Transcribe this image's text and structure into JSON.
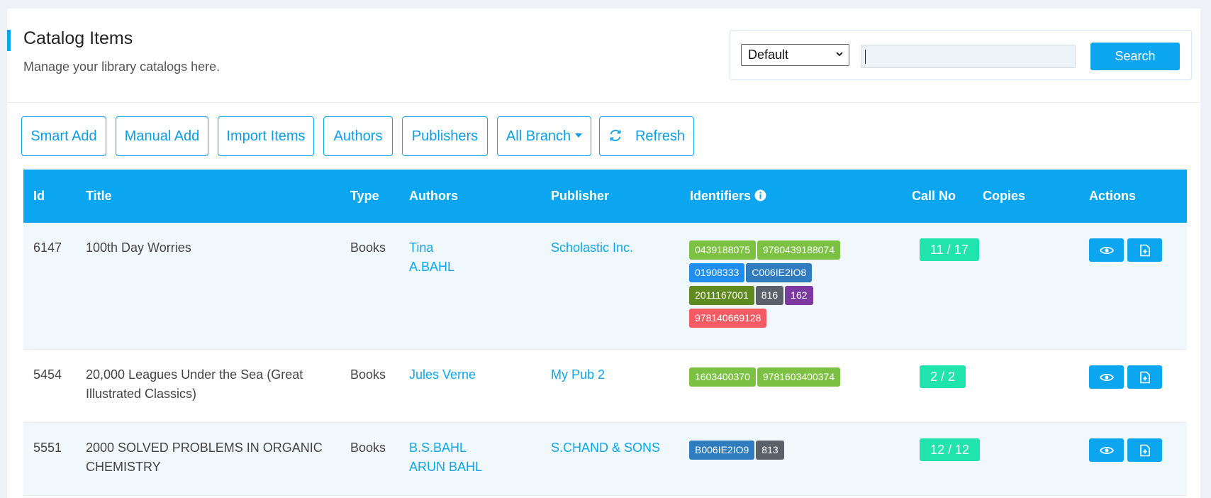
{
  "header": {
    "title": "Catalog Items",
    "subtitle": "Manage your library catalogs here.",
    "search": {
      "select_value": "Default",
      "input_value": "",
      "button_label": "Search"
    }
  },
  "toolbar": {
    "smart_add": "Smart Add",
    "manual_add": "Manual Add",
    "import_items": "Import Items",
    "authors": "Authors",
    "publishers": "Publishers",
    "all_branch": "All Branch",
    "refresh": "Refresh"
  },
  "table": {
    "columns": {
      "id": "Id",
      "title": "Title",
      "type": "Type",
      "authors": "Authors",
      "publisher": "Publisher",
      "identifiers": "Identifiers",
      "call_no": "Call No",
      "copies": "Copies",
      "actions": "Actions"
    },
    "rows": [
      {
        "id": "6147",
        "title_line1": "100th Day Worries",
        "title_line2": "",
        "type": "Books",
        "author1": "Tina",
        "author2": "A.BAHL",
        "publisher": "Scholastic Inc.",
        "identifiers": [
          {
            "text": "0439188075",
            "color": "#7cc142"
          },
          {
            "text": "9780439188074",
            "color": "#7cc142"
          },
          {
            "text": "01908333",
            "color": "#1e8ef0"
          },
          {
            "text": "C006IE2IO8",
            "color": "#2f7cbf"
          },
          {
            "text": "2011167001",
            "color": "#5f8a1f"
          },
          {
            "text": "816",
            "color": "#5b6168"
          },
          {
            "text": "162",
            "color": "#7c3aa0"
          },
          {
            "text": "978140669128",
            "color": "#f55b63"
          }
        ],
        "call_no": "",
        "copies": "11 / 17"
      },
      {
        "id": "5454",
        "title_line1": "20,000 Leagues Under the Sea (Great",
        "title_line2": "Illustrated Classics)",
        "type": "Books",
        "author1": "Jules Verne",
        "author2": "",
        "publisher": "My Pub 2",
        "identifiers": [
          {
            "text": "1603400370",
            "color": "#7cc142"
          },
          {
            "text": "9781603400374",
            "color": "#7cc142"
          }
        ],
        "call_no": "",
        "copies": "2 / 2"
      },
      {
        "id": "5551",
        "title_line1": "2000 SOLVED PROBLEMS IN ORGANIC",
        "title_line2": "CHEMISTRY",
        "type": "Books",
        "author1": "B.S.BAHL",
        "author2": "ARUN BAHL",
        "publisher": "S.CHAND & SONS",
        "identifiers": [
          {
            "text": "B006IE2IO9",
            "color": "#2f7cbf"
          },
          {
            "text": "813",
            "color": "#5b6168"
          }
        ],
        "call_no": "",
        "copies": "12 / 12"
      }
    ]
  },
  "colors": {
    "accent": "#0ba6ef",
    "copies_badge": "#20e3ad"
  }
}
